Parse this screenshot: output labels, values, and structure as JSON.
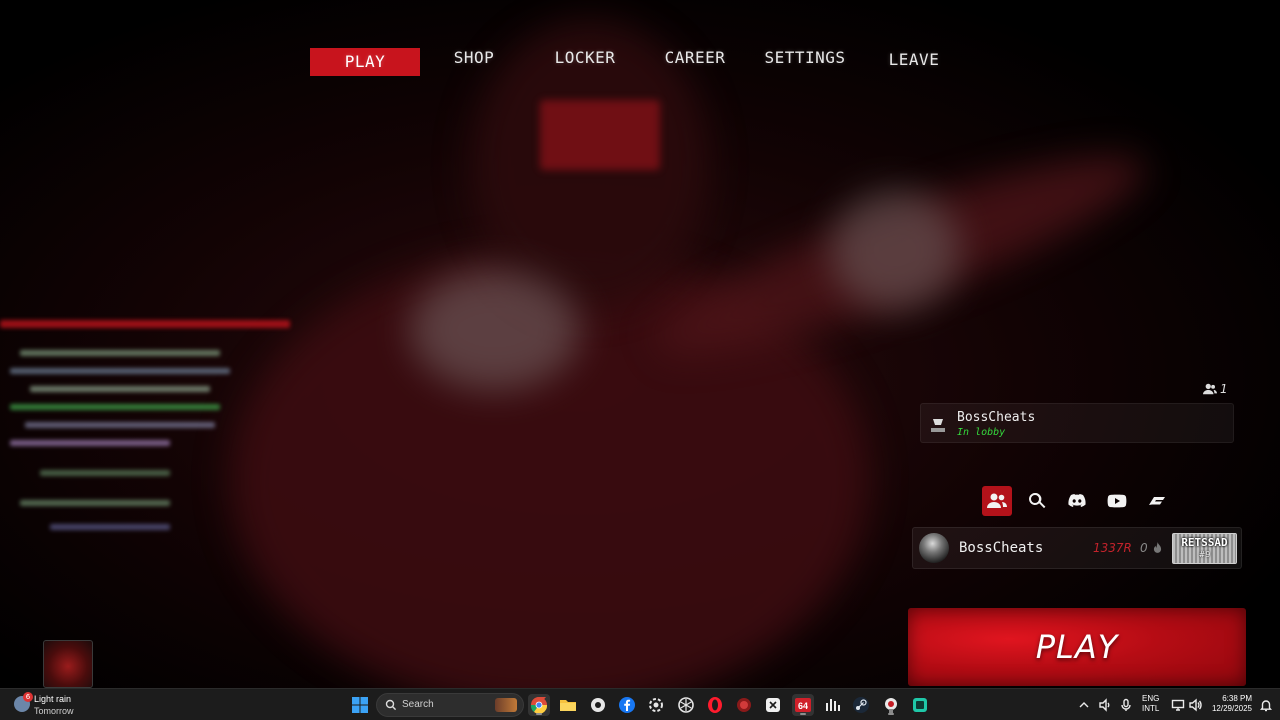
{
  "nav": {
    "items": [
      {
        "label": "PLAY",
        "active": true
      },
      {
        "label": "SHOP",
        "active": false
      },
      {
        "label": "LOCKER",
        "active": false
      },
      {
        "label": "CAREER",
        "active": false
      },
      {
        "label": "SETTINGS",
        "active": false
      },
      {
        "label": "LEAVE",
        "active": false
      }
    ]
  },
  "party": {
    "count": "1",
    "count_icon": "party-members-icon",
    "member": {
      "name": "BossCheats",
      "status": "In lobby",
      "avatar_icon": "boss-logo-icon"
    }
  },
  "social": {
    "buttons": [
      {
        "icon": "friends-icon",
        "active": true
      },
      {
        "icon": "search-icon",
        "active": false
      },
      {
        "icon": "discord-icon",
        "active": false
      },
      {
        "icon": "youtube-icon",
        "active": false
      },
      {
        "icon": "brand-logo-icon",
        "active": false
      }
    ]
  },
  "profile": {
    "name": "BossCheats",
    "currency": "1337R",
    "streak": "0",
    "streak_icon": "flame-icon",
    "badge_text": "RETSSAD",
    "badge_sub": "#9"
  },
  "play_button": {
    "label": "PLAY"
  },
  "colors": {
    "accent": "#c8141d",
    "status_online": "#35d63c",
    "currency": "#c3232b"
  },
  "taskbar": {
    "weather": {
      "main": "Light rain",
      "sub": "Tomorrow",
      "badge": "6"
    },
    "search_placeholder": "Search",
    "apps": [
      "windows-start-icon",
      "chrome-icon",
      "file-explorer-icon",
      "settings-app-icon",
      "facebook-icon",
      "app-icon",
      "chatgpt-icon",
      "opera-icon",
      "app-icon",
      "app-icon",
      "app-64-icon",
      "audio-app-icon",
      "steam-icon",
      "game-app-icon",
      "app-icon"
    ],
    "language": {
      "line1": "ENG",
      "line2": "INTL"
    },
    "clock": {
      "time": "6:38 PM",
      "date": "12/29/2025"
    }
  }
}
